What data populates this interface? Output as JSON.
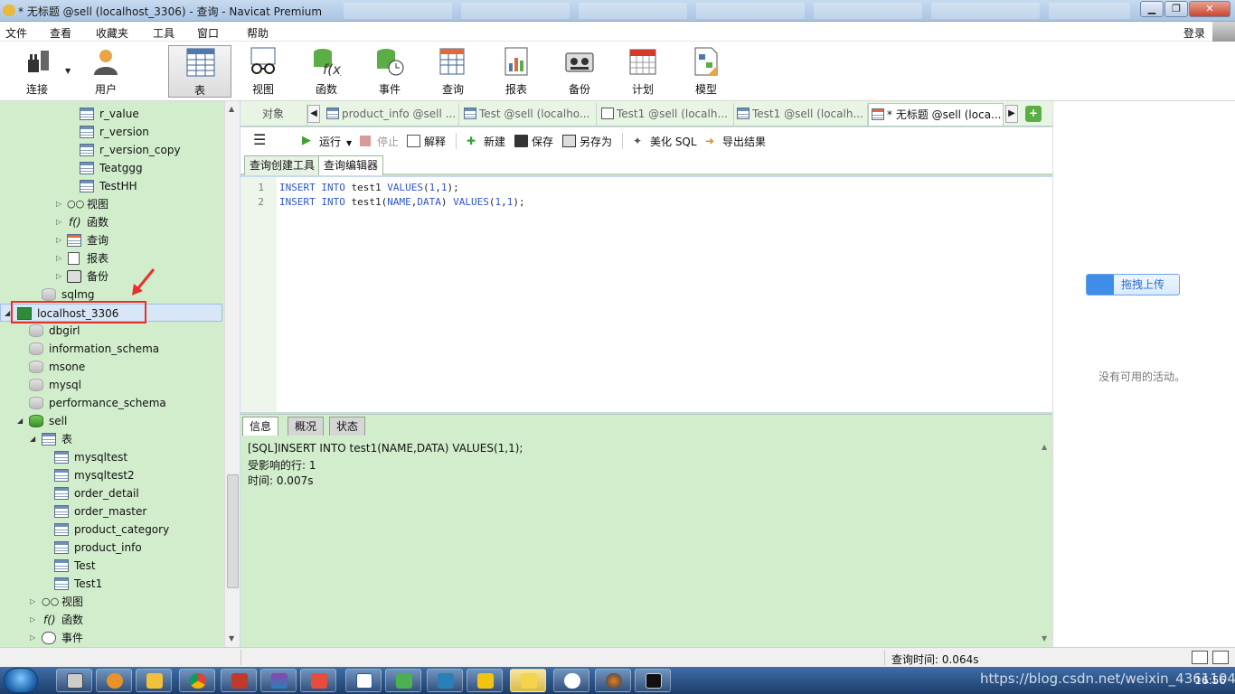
{
  "window": {
    "title": "* 无标题 @sell (localhost_3306) - 查询 - Navicat Premium",
    "btn_min": "▁",
    "btn_max": "❐",
    "btn_close": "✕"
  },
  "menubar": {
    "items": [
      "文件",
      "查看",
      "收藏夹",
      "工具",
      "窗口",
      "帮助"
    ],
    "login": "登录"
  },
  "toolbar": {
    "tools": [
      {
        "label": "连接",
        "icon": "plug-icon"
      },
      {
        "label": "用户",
        "icon": "user-icon"
      },
      {
        "label": "表",
        "icon": "table-icon",
        "active": true
      },
      {
        "label": "视图",
        "icon": "view-glasses-icon"
      },
      {
        "label": "函数",
        "icon": "function-icon"
      },
      {
        "label": "事件",
        "icon": "event-icon"
      },
      {
        "label": "查询",
        "icon": "query-icon"
      },
      {
        "label": "报表",
        "icon": "report-icon"
      },
      {
        "label": "备份",
        "icon": "backup-icon"
      },
      {
        "label": "计划",
        "icon": "schedule-icon"
      },
      {
        "label": "模型",
        "icon": "model-icon"
      }
    ]
  },
  "tree": {
    "nodes": [
      {
        "label": "r_value",
        "type": "table"
      },
      {
        "label": "r_version",
        "type": "table"
      },
      {
        "label": "r_version_copy",
        "type": "table"
      },
      {
        "label": "Teatggg",
        "type": "table"
      },
      {
        "label": "TestHH",
        "type": "table"
      },
      {
        "label": "视图",
        "type": "view"
      },
      {
        "label": "函数",
        "type": "func"
      },
      {
        "label": "查询",
        "type": "query"
      },
      {
        "label": "报表",
        "type": "report"
      },
      {
        "label": "备份",
        "type": "backup"
      },
      {
        "label": "sqlmg",
        "type": "db"
      },
      {
        "label": "localhost_3306",
        "type": "conn"
      },
      {
        "label": "dbgirl",
        "type": "db"
      },
      {
        "label": "information_schema",
        "type": "db"
      },
      {
        "label": "msone",
        "type": "db"
      },
      {
        "label": "mysql",
        "type": "db"
      },
      {
        "label": "performance_schema",
        "type": "db"
      },
      {
        "label": "sell",
        "type": "dbopen"
      },
      {
        "label": "表",
        "type": "tables"
      },
      {
        "label": "mysqltest",
        "type": "table"
      },
      {
        "label": "mysqltest2",
        "type": "table"
      },
      {
        "label": "order_detail",
        "type": "table"
      },
      {
        "label": "order_master",
        "type": "table"
      },
      {
        "label": "product_category",
        "type": "table"
      },
      {
        "label": "product_info",
        "type": "table"
      },
      {
        "label": "Test",
        "type": "table"
      },
      {
        "label": "Test1",
        "type": "table"
      },
      {
        "label": "视图",
        "type": "view"
      },
      {
        "label": "函数",
        "type": "func"
      },
      {
        "label": "事件",
        "type": "event"
      }
    ]
  },
  "tabs": {
    "objects": "对象",
    "items": [
      "product_info @sell ...",
      "Test @sell (localho...",
      "Test1 @sell (localh...",
      "Test1 @sell (localh...",
      "* 无标题 @sell (loca..."
    ]
  },
  "query_toolbar": {
    "run": "运行",
    "stop": "停止",
    "explain": "解释",
    "new": "新建",
    "save": "保存",
    "save_as": "另存为",
    "beautify": "美化 SQL",
    "export": "导出结果"
  },
  "sub_tabs": [
    "查询创建工具",
    "查询编辑器"
  ],
  "editor": {
    "lines": [
      {
        "no": "1",
        "parts": [
          [
            "kw",
            "INSERT"
          ],
          [
            "t",
            " "
          ],
          [
            "kw",
            "INTO"
          ],
          [
            "t",
            " test1 "
          ],
          [
            "kw",
            "VALUES"
          ],
          [
            "t",
            "("
          ],
          [
            "num",
            "1"
          ],
          [
            "t",
            ","
          ],
          [
            "num",
            "1"
          ],
          [
            "t",
            ");"
          ]
        ]
      },
      {
        "no": "2",
        "parts": [
          [
            "kw",
            "INSERT"
          ],
          [
            "t",
            " "
          ],
          [
            "kw",
            "INTO"
          ],
          [
            "t",
            " test1("
          ],
          [
            "kw",
            "NAME"
          ],
          [
            "t",
            ","
          ],
          [
            "kw",
            "DATA"
          ],
          [
            "t",
            ") "
          ],
          [
            "kw",
            "VALUES"
          ],
          [
            "t",
            "("
          ],
          [
            "num",
            "1"
          ],
          [
            "t",
            ","
          ],
          [
            "num",
            "1"
          ],
          [
            "t",
            ");"
          ]
        ]
      }
    ]
  },
  "bottom_tabs": [
    "信息",
    "概况",
    "状态"
  ],
  "info": {
    "lines": [
      "[SQL]INSERT INTO test1(NAME,DATA) VALUES(1,1);",
      "受影响的行: 1",
      "时间: 0.007s"
    ]
  },
  "right": {
    "upload": "拖拽上传",
    "no_activity": "没有可用的活动。"
  },
  "status": {
    "query_time": "查询时间: 0.064s"
  },
  "taskbar": {
    "clock": "16:56"
  },
  "watermark": "https://blog.csdn.net/weixin_43611048",
  "colors": {
    "tree_bg": "#d1edcc",
    "keyword": "#2f56c8",
    "highlight_box": "#e8312a"
  }
}
